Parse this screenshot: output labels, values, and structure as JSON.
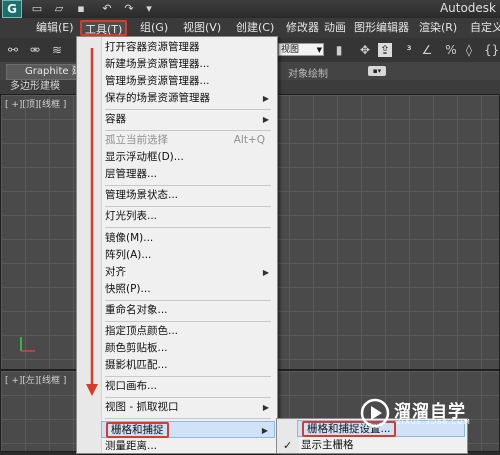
{
  "window": {
    "app_title": "Autodesk"
  },
  "menubar": {
    "items": [
      "编辑(E)",
      "工具(T)",
      "组(G)",
      "视图(V)",
      "创建(C)",
      "修改器",
      "动画",
      "图形编辑器",
      "渲染(R)",
      "自定义"
    ]
  },
  "toolbar": {
    "view_select": "视图"
  },
  "ribbon": {
    "tab": "Graphite 建",
    "right_label": "对象绘制"
  },
  "subbar": {
    "label": "多边形建模"
  },
  "viewports": {
    "top_label": "[ +][顶][线框 ]",
    "bottom_label": "[ +][左][线框 ]"
  },
  "tools_menu": {
    "items": [
      {
        "label": "打开容器资源管理器",
        "submenu": false,
        "disabled": false
      },
      {
        "label": "新建场景资源管理器...",
        "submenu": false,
        "disabled": false
      },
      {
        "label": "管理场景资源管理器...",
        "submenu": false,
        "disabled": false
      },
      {
        "label": "保存的场景资源管理器",
        "submenu": true,
        "disabled": false
      },
      {
        "label": "容器",
        "submenu": true,
        "disabled": false
      },
      {
        "label": "孤立当前选择",
        "shortcut": "Alt+Q",
        "submenu": false,
        "disabled": true
      },
      {
        "label": "显示浮动框(D)...",
        "submenu": false,
        "disabled": false
      },
      {
        "label": "层管理器...",
        "submenu": false,
        "disabled": false
      },
      {
        "label": "管理场景状态...",
        "submenu": false,
        "disabled": false
      },
      {
        "label": "灯光列表...",
        "submenu": false,
        "disabled": false
      },
      {
        "label": "镜像(M)...",
        "submenu": false,
        "disabled": false
      },
      {
        "label": "阵列(A)...",
        "submenu": false,
        "disabled": false
      },
      {
        "label": "对齐",
        "submenu": true,
        "disabled": false
      },
      {
        "label": "快照(P)...",
        "submenu": false,
        "disabled": false
      },
      {
        "label": "重命名对象...",
        "submenu": false,
        "disabled": false
      },
      {
        "label": "指定顶点颜色...",
        "submenu": false,
        "disabled": false
      },
      {
        "label": "颜色剪贴板...",
        "submenu": false,
        "disabled": false
      },
      {
        "label": "摄影机匹配...",
        "submenu": false,
        "disabled": false
      },
      {
        "label": "视口画布...",
        "submenu": false,
        "disabled": false
      },
      {
        "label": "视图 - 抓取视口",
        "submenu": true,
        "disabled": false
      },
      {
        "label": "栅格和捕捉",
        "submenu": true,
        "disabled": false
      },
      {
        "label": "测量距离...",
        "submenu": false,
        "disabled": false
      }
    ]
  },
  "grid_submenu": {
    "items": [
      {
        "label": "栅格和捕捉设置..."
      },
      {
        "label": "显示主栅格",
        "checked": true
      }
    ]
  },
  "watermark": {
    "title": "溜溜自学",
    "url": "ZIXUE.3D66.COM"
  },
  "colors": {
    "highlight_red": "#d93b2a",
    "menu_bg": "#f0f0f0"
  }
}
